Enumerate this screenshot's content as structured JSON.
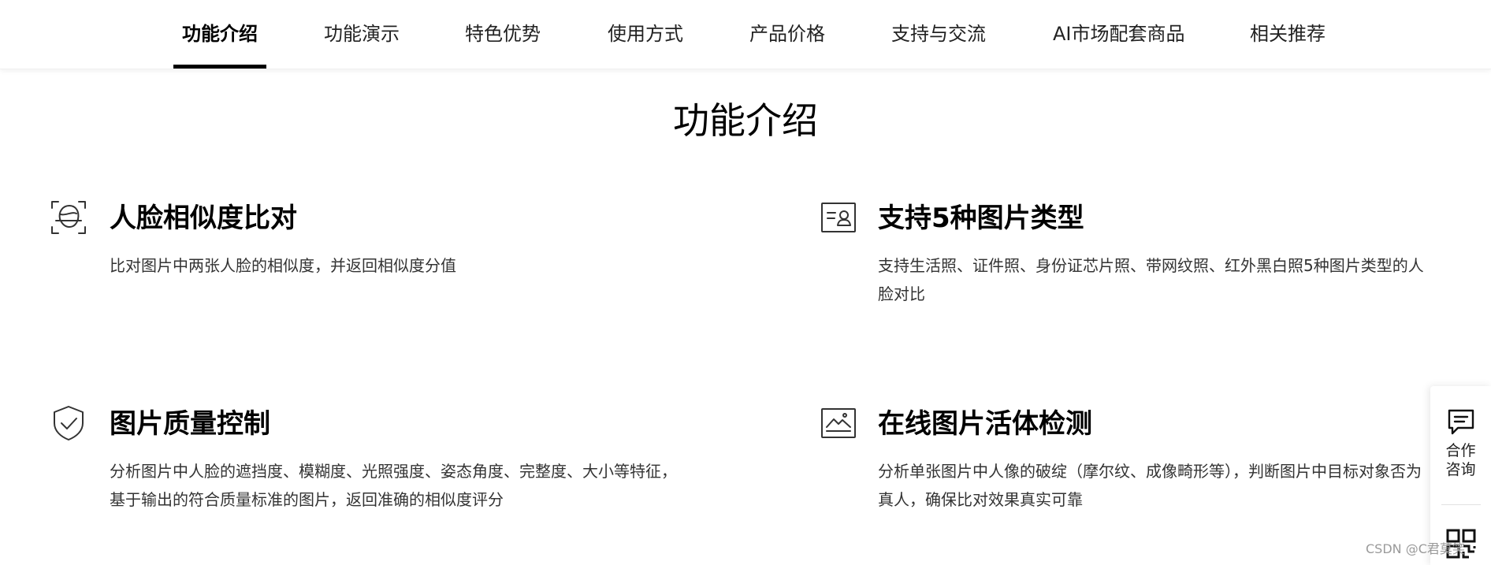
{
  "nav": {
    "tabs": [
      {
        "label": "功能介绍",
        "active": true
      },
      {
        "label": "功能演示",
        "active": false
      },
      {
        "label": "特色优势",
        "active": false
      },
      {
        "label": "使用方式",
        "active": false
      },
      {
        "label": "产品价格",
        "active": false
      },
      {
        "label": "支持与交流",
        "active": false
      },
      {
        "label": "AI市场配套商品",
        "active": false
      },
      {
        "label": "相关推荐",
        "active": false
      }
    ]
  },
  "section": {
    "title": "功能介绍"
  },
  "features": [
    {
      "icon": "face-scan-icon",
      "title": "人脸相似度比对",
      "desc": "比对图片中两张人脸的相似度，并返回相似度分值"
    },
    {
      "icon": "id-card-icon",
      "title": "支持5种图片类型",
      "desc": "支持生活照、证件照、身份证芯片照、带网纹照、红外黑白照5种图片类型的人脸对比"
    },
    {
      "icon": "shield-check-icon",
      "title": "图片质量控制",
      "desc": "分析图片中人脸的遮挡度、模糊度、光照强度、姿态角度、完整度、大小等特征，基于输出的符合质量标准的图片，返回准确的相似度评分"
    },
    {
      "icon": "image-liveness-icon",
      "title": "在线图片活体检测",
      "desc": "分析单张图片中人像的破绽（摩尔纹、成像畸形等），判断图片中目标对象否为真人，确保比对效果真实可靠"
    }
  ],
  "side_float": {
    "consult_label": "合作咨询",
    "consult_icon": "chat-message-icon",
    "qr_icon": "qr-code-icon"
  },
  "watermark": "CSDN @C君莫笑"
}
